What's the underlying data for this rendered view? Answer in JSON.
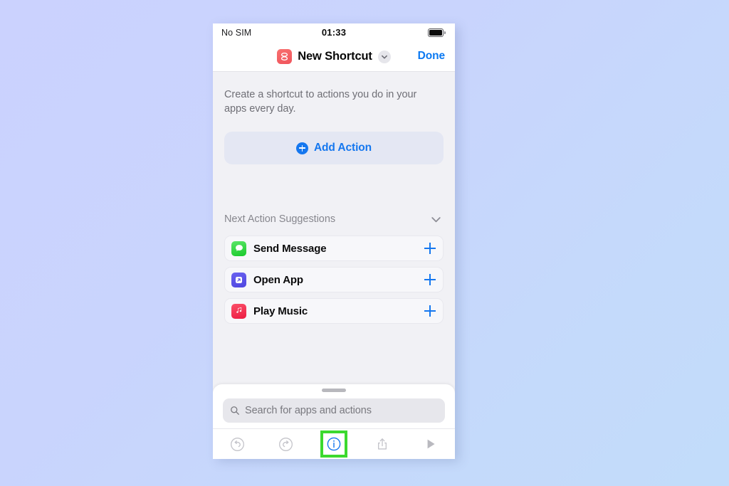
{
  "status_bar": {
    "carrier": "No SIM",
    "time": "01:33",
    "battery_icon": "battery-full-icon"
  },
  "nav_bar": {
    "app_icon": "shortcuts-app-icon",
    "app_icon_color": "#f0545c",
    "title": "New Shortcut",
    "chevron_icon": "chevron-down-icon",
    "done_label": "Done",
    "done_color": "#0b79f2"
  },
  "canvas": {
    "intro_text": "Create a shortcut to actions you do in your apps every day.",
    "add_action": {
      "label": "Add Action",
      "icon": "plus-circle-icon",
      "accent_color": "#1577ef",
      "background_color": "#e4e7f3"
    },
    "suggestions": {
      "header_label": "Next Action Suggestions",
      "collapse_icon": "chevron-down-icon",
      "items": [
        {
          "label": "Send Message",
          "icon": "messages-app-icon",
          "icon_color": "#19c92b",
          "add_icon": "plus-icon"
        },
        {
          "label": "Open App",
          "icon": "open-app-icon",
          "icon_color": "#4f46e0",
          "add_icon": "plus-icon"
        },
        {
          "label": "Play Music",
          "icon": "music-app-icon",
          "icon_color": "#ec1d43",
          "add_icon": "plus-icon"
        }
      ]
    }
  },
  "sheet": {
    "grabber_icon": "drag-handle-icon",
    "search": {
      "icon": "search-icon",
      "placeholder": "Search for apps and actions",
      "value": ""
    },
    "toolbar": {
      "items": [
        {
          "icon": "undo-icon",
          "highlighted": false
        },
        {
          "icon": "redo-icon",
          "highlighted": false
        },
        {
          "icon": "info-icon",
          "highlighted": true
        },
        {
          "icon": "share-icon",
          "highlighted": false
        },
        {
          "icon": "play-icon",
          "highlighted": false
        }
      ],
      "highlight_color": "#3bd92f",
      "active_icon_color": "#1577ef",
      "inactive_icon_color": "#c4c4ca"
    }
  }
}
